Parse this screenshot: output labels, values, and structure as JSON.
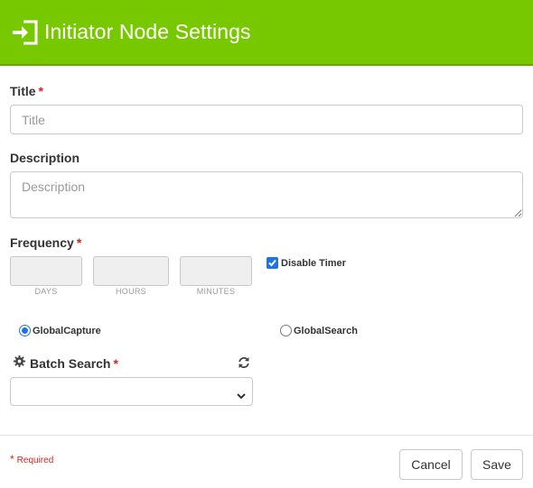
{
  "header": {
    "title": "Initiator Node Settings",
    "icon": "sign-in-icon",
    "background_color": "#78c800"
  },
  "form": {
    "title_field": {
      "label": "Title",
      "required_mark": "*",
      "placeholder": "Title",
      "value": ""
    },
    "description_field": {
      "label": "Description",
      "placeholder": "Description",
      "value": ""
    },
    "frequency": {
      "label": "Frequency",
      "required_mark": "*",
      "fields": [
        {
          "label": "DAYS",
          "value": ""
        },
        {
          "label": "HOURS",
          "value": ""
        },
        {
          "label": "MINUTES",
          "value": ""
        }
      ],
      "disable_timer": {
        "label": "Disable Timer",
        "checked": true
      }
    },
    "source": {
      "options": [
        {
          "label": "GlobalCapture",
          "selected": true
        },
        {
          "label": "GlobalSearch",
          "selected": false
        }
      ]
    },
    "batch_search": {
      "label": "Batch Search",
      "required_mark": "*",
      "icon": "gear-icon",
      "refresh_icon": "refresh-icon",
      "selected_value": ""
    }
  },
  "footer": {
    "required_note": {
      "star": "*",
      "text": "Required"
    },
    "cancel_label": "Cancel",
    "save_label": "Save"
  },
  "colors": {
    "accent_blue": "#1f72e8",
    "required_red": "#d9221c"
  }
}
